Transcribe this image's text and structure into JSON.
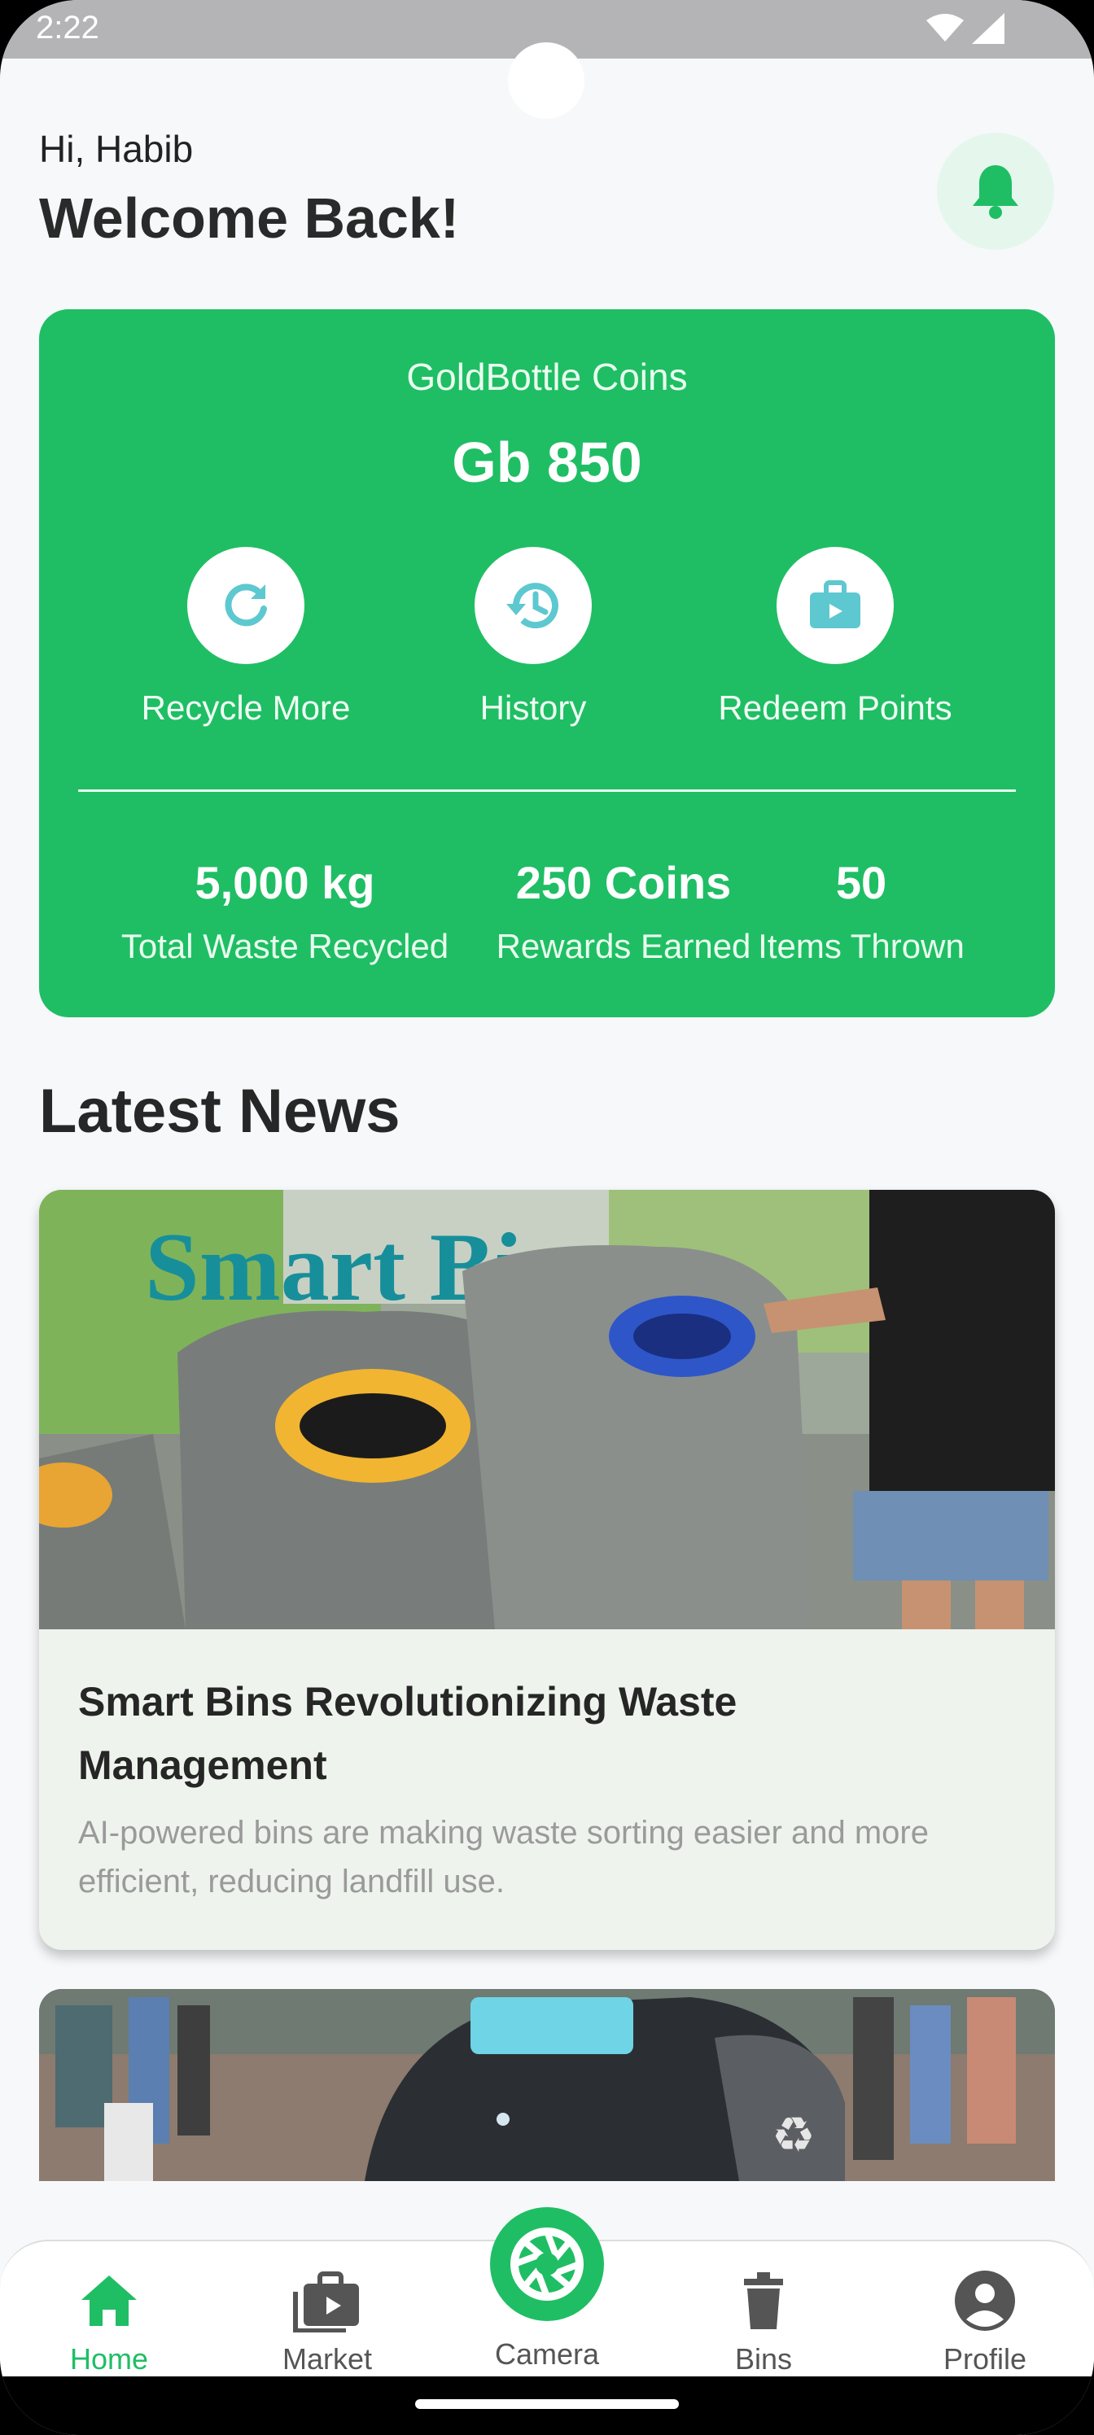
{
  "status_bar": {
    "time": "2:22"
  },
  "header": {
    "greeting": "Hi, Habib",
    "title": "Welcome Back!"
  },
  "coins_card": {
    "label": "GoldBottle Coins",
    "value": "Gb 850",
    "actions": [
      {
        "label": "Recycle More",
        "icon": "refresh-icon"
      },
      {
        "label": "History",
        "icon": "history-icon"
      },
      {
        "label": "Redeem Points",
        "icon": "briefcase-icon"
      }
    ],
    "stats": [
      {
        "value": "5,000 kg",
        "label": "Total Waste Recycled"
      },
      {
        "value": "250 Coins",
        "label": "Rewards Earned"
      },
      {
        "value": "50",
        "label": "Items Thrown"
      }
    ]
  },
  "news": {
    "heading": "Latest News",
    "items": [
      {
        "image_text": "Smart Bins",
        "title": "Smart Bins Revolutionizing Waste Management",
        "description": "AI-powered bins are making waste sorting easier and more efficient, reducing landfill use."
      }
    ]
  },
  "bottom_nav": {
    "items": [
      {
        "label": "Home",
        "icon": "home-icon",
        "active": true
      },
      {
        "label": "Market",
        "icon": "market-icon"
      },
      {
        "label": "Camera",
        "icon": "camera-shutter-icon"
      },
      {
        "label": "Bins",
        "icon": "trash-icon"
      },
      {
        "label": "Profile",
        "icon": "profile-icon"
      }
    ]
  },
  "colors": {
    "primary": "#1fbe64",
    "background": "#f6f8fa",
    "icon_teal": "#5ec8d0"
  }
}
